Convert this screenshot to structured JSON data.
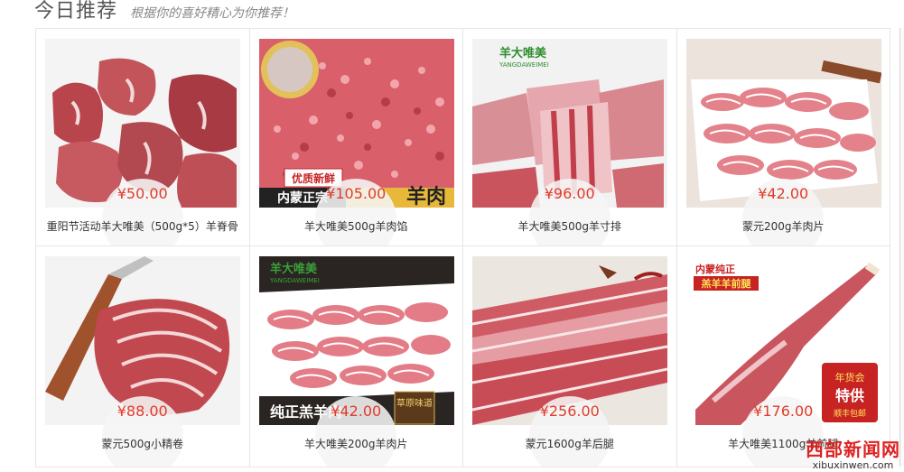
{
  "header": {
    "title": "今日推荐",
    "subtitle": "根据你的喜好精心为你推荐！"
  },
  "products": [
    {
      "name": "重阳节活动羊大唯美（500g*5）羊脊骨",
      "price": "¥50.00",
      "image": "lamb-spine-chunks"
    },
    {
      "name": "羊大唯美500g羊肉馅",
      "price": "¥105.00",
      "image": "minced-lamb",
      "image_text": [
        "优质新鲜",
        "内蒙正宗",
        "羊肉"
      ]
    },
    {
      "name": "羊大唯美500g羊寸排",
      "price": "¥96.00",
      "image": "lamb-ribs",
      "image_text": [
        "羊大唯美",
        "YANGDAWEIMEI"
      ]
    },
    {
      "name": "蒙元200g羊肉片",
      "price": "¥42.00",
      "image": "lamb-slices-plate"
    },
    {
      "name": "蒙元500g小精卷",
      "price": "¥88.00",
      "image": "lamb-rolls-knife"
    },
    {
      "name": "羊大唯美200g羊肉片",
      "price": "¥42.00",
      "image": "lamb-slices-tray",
      "image_text": [
        "羊大唯美",
        "YANGDAWEIMEI",
        "纯正羔羊肉",
        "草原味道"
      ]
    },
    {
      "name": "蒙元1600g羊后腿",
      "price": "¥256.00",
      "image": "lamb-hind-leg-slices"
    },
    {
      "name": "羊大唯美1100g羊前腿",
      "price": "¥176.00",
      "image": "lamb-front-leg",
      "image_text": [
        "内蒙纯正",
        "羔羊羊前腿",
        "年货会",
        "特供",
        "顺丰包邮"
      ]
    }
  ],
  "watermark": {
    "top": "西部新闻网",
    "bottom": "xibuxinwen.com"
  }
}
